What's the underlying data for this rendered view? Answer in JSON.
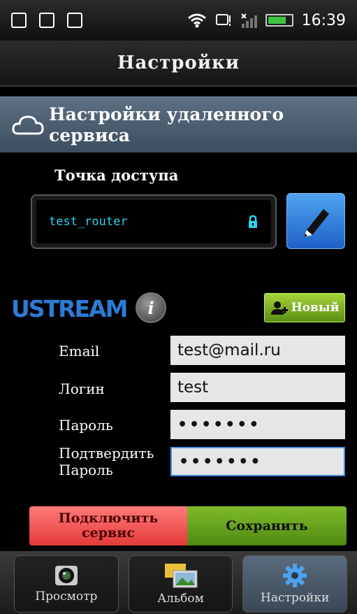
{
  "status_bar": {
    "time": "16:39",
    "battery_level": 0.8
  },
  "title": "Настройки",
  "section": {
    "title_line1": "Настройки удаленного",
    "title_line2": "сервиса",
    "icon": "cloud-icon"
  },
  "access_point": {
    "label": "Точка доступа",
    "value": "test_router",
    "lock_icon": "lock-icon",
    "edit_icon": "pencil-icon"
  },
  "ustream": {
    "logo": "USTREAM",
    "info_icon": "i",
    "new_button": "Новый"
  },
  "form": {
    "email_label": "Email",
    "email_value": "test@mail.ru",
    "login_label": "Логин",
    "login_value": "test",
    "password_label": "Пароль",
    "password_value": "•••••••",
    "confirm_label_1": "Подтвердить",
    "confirm_label_2": "Пароль",
    "confirm_value": "•••••••"
  },
  "buttons": {
    "connect_line1": "Подключить",
    "connect_line2": "сервис",
    "save": "Сохранить"
  },
  "bottom_nav": {
    "items": [
      {
        "label": "Просмотр"
      },
      {
        "label": "Альбом"
      },
      {
        "label": "Настройки"
      }
    ]
  },
  "colors": {
    "accent": "#2b7cd6",
    "ap_text": "#2fd0f0",
    "connect": "#e43a3a",
    "save": "#5a9a16"
  }
}
